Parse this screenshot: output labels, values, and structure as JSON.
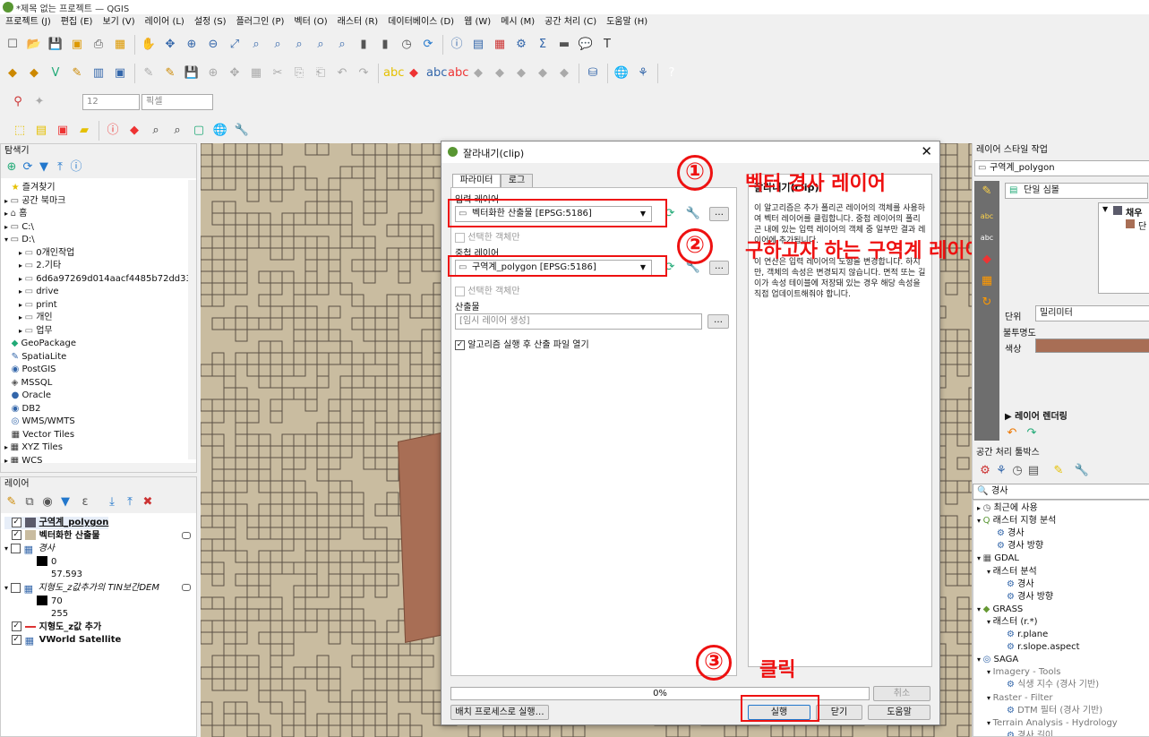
{
  "window": {
    "title": "*제목 없는 프로젝트 — QGIS"
  },
  "menu": [
    "프로젝트 (J)",
    "편집 (E)",
    "보기 (V)",
    "레이어 (L)",
    "설정 (S)",
    "플러그인 (P)",
    "벡터 (O)",
    "래스터 (R)",
    "데이터베이스 (D)",
    "웹 (W)",
    "메시 (M)",
    "공간 처리 (C)",
    "도움말 (H)"
  ],
  "snap": {
    "tolerance": "12",
    "unit": "픽셀"
  },
  "browser": {
    "title": "탐색기",
    "items": [
      {
        "label": "즐겨찾기",
        "indent": 1,
        "icon": "star-icon"
      },
      {
        "label": "공간 북마크",
        "indent": 1,
        "icon": "bookmark-icon"
      },
      {
        "label": "홈",
        "indent": 1,
        "icon": "home-icon"
      },
      {
        "label": "C:\\",
        "indent": 1,
        "icon": "drive-icon"
      },
      {
        "label": "D:\\",
        "indent": 1,
        "icon": "drive-icon"
      },
      {
        "label": "0개인작업",
        "indent": 2,
        "icon": "folder-icon"
      },
      {
        "label": "2.기타",
        "indent": 2,
        "icon": "folder-icon"
      },
      {
        "label": "6d6a97269d014aacf4485b72dd33",
        "indent": 2,
        "icon": "folder-icon"
      },
      {
        "label": "drive",
        "indent": 2,
        "icon": "folder-icon"
      },
      {
        "label": "print",
        "indent": 2,
        "icon": "folder-icon"
      },
      {
        "label": "개인",
        "indent": 2,
        "icon": "folder-icon"
      },
      {
        "label": "업무",
        "indent": 2,
        "icon": "folder-icon"
      },
      {
        "label": "GeoPackage",
        "indent": 1,
        "icon": "geopackage-icon"
      },
      {
        "label": "SpatiaLite",
        "indent": 1,
        "icon": "spatialite-icon"
      },
      {
        "label": "PostGIS",
        "indent": 1,
        "icon": "postgis-icon"
      },
      {
        "label": "MSSQL",
        "indent": 1,
        "icon": "mssql-icon"
      },
      {
        "label": "Oracle",
        "indent": 1,
        "icon": "oracle-icon"
      },
      {
        "label": "DB2",
        "indent": 1,
        "icon": "db2-icon"
      },
      {
        "label": "WMS/WMTS",
        "indent": 1,
        "icon": "wms-icon"
      },
      {
        "label": "Vector Tiles",
        "indent": 1,
        "icon": "vector-tiles-icon"
      },
      {
        "label": "XYZ Tiles",
        "indent": 1,
        "icon": "xyz-icon"
      },
      {
        "label": "WCS",
        "indent": 1,
        "icon": "wcs-icon"
      }
    ]
  },
  "layers": {
    "title": "레이어",
    "items": [
      {
        "label": "구역계_polygon",
        "checked": true,
        "bold": true,
        "underline": true,
        "swatch": "#5b5b6b"
      },
      {
        "label": "벡터화한 산출물",
        "checked": true,
        "bold": true,
        "swatch": "#c9bca0"
      },
      {
        "label": "경사",
        "checked": false,
        "italic": true
      },
      {
        "label": "0",
        "legend": true,
        "swatch": "#000000"
      },
      {
        "label": "57.593",
        "legend": true
      },
      {
        "label": "지형도_z값추가의 TIN보간DEM",
        "checked": false,
        "italic": true
      },
      {
        "label": "70",
        "legend": true,
        "swatch": "#000000"
      },
      {
        "label": "255",
        "legend": true
      },
      {
        "label": "지형도_z값 추가",
        "checked": true,
        "bold": true,
        "line": true
      },
      {
        "label": "VWorld Satellite",
        "checked": true,
        "bold": true
      }
    ]
  },
  "dialog": {
    "title": "잘라내기(clip)",
    "tabs": [
      "파라미터",
      "로그"
    ],
    "input_label": "입력 레이어",
    "input_value": "벡터화한 산출물 [EPSG:5186]",
    "selected_only_1": "선택한 객체만",
    "overlay_label": "중첩 레이어",
    "overlay_value": "구역계_polygon [EPSG:5186]",
    "selected_only_2": "선택한 객체만",
    "output_label": "산출물",
    "output_placeholder": "[임시 레이어 생성]",
    "open_after": "알고리즘 실행 후 산출 파일 열기",
    "help_title": "잘라내기(clip)",
    "help_text": "이 알고리즘은 추가 폴리곤 레이어의 객체를 사용하여 벡터 레이어를 클립합니다. 중첩 레이어의 폴리곤 내에 있는 입력 레이어의 객체 중 일부만 결과 레이어에 추가됩니다.\n\n이 연산은 입력 레이어의 도형을 변경합니다. 하지만, 객체의 속성은 변경되지 않습니다. 면적 또는 길이가 속성 테이블에 저장돼 있는 경우 해당 속성을 직접 업데이트해줘야 합니다.",
    "progress": "0%",
    "cancel": "취소",
    "batch": "배치 프로세스로 실행…",
    "run": "실행",
    "close": "닫기",
    "help": "도움말"
  },
  "annotations": {
    "n1": "①",
    "t1": "벡터 경사 레이어",
    "n2": "②",
    "t2": "구하고자 하는 구역계 레이어",
    "n3": "③",
    "t3": "클릭"
  },
  "style_panel": {
    "title": "레이어 스타일 작업",
    "layer": "구역계_polygon",
    "renderer": "단일 심볼",
    "fill_label": "채우",
    "fill_sub": "단",
    "unit_label": "단위",
    "unit_value": "밀리미터",
    "opacity_label": "불투명도",
    "color_label": "색상",
    "color": "#a86e55",
    "rendering": "레이어 렌더링"
  },
  "toolbox": {
    "title": "공간 처리 툴박스",
    "search": "경사",
    "items": [
      {
        "label": "최근에 사용",
        "indent": 0,
        "arrow": "▸"
      },
      {
        "label": "래스터 지형 분석",
        "indent": 0,
        "arrow": "▾"
      },
      {
        "label": "경사",
        "indent": 2
      },
      {
        "label": "경사 방향",
        "indent": 2
      },
      {
        "label": "GDAL",
        "indent": 0,
        "arrow": "▾"
      },
      {
        "label": "래스터 분석",
        "indent": 1,
        "arrow": "▾"
      },
      {
        "label": "경사",
        "indent": 3
      },
      {
        "label": "경사 방향",
        "indent": 3
      },
      {
        "label": "GRASS",
        "indent": 0,
        "arrow": "▾"
      },
      {
        "label": "래스터 (r.*)",
        "indent": 1,
        "arrow": "▾"
      },
      {
        "label": "r.plane",
        "indent": 3
      },
      {
        "label": "r.slope.aspect",
        "indent": 3
      },
      {
        "label": "SAGA",
        "indent": 0,
        "arrow": "▾"
      },
      {
        "label": "Imagery - Tools",
        "indent": 1,
        "arrow": "▾",
        "grey": true
      },
      {
        "label": "식생 지수 (경사 기반)",
        "indent": 3,
        "grey": true
      },
      {
        "label": "Raster - Filter",
        "indent": 1,
        "arrow": "▾",
        "grey": true
      },
      {
        "label": "DTM 필터 (경사 기반)",
        "indent": 3,
        "grey": true
      },
      {
        "label": "Terrain Analysis - Hydrology",
        "indent": 1,
        "arrow": "▾",
        "grey": true
      },
      {
        "label": "경사 길이",
        "indent": 3,
        "grey": true
      }
    ]
  }
}
